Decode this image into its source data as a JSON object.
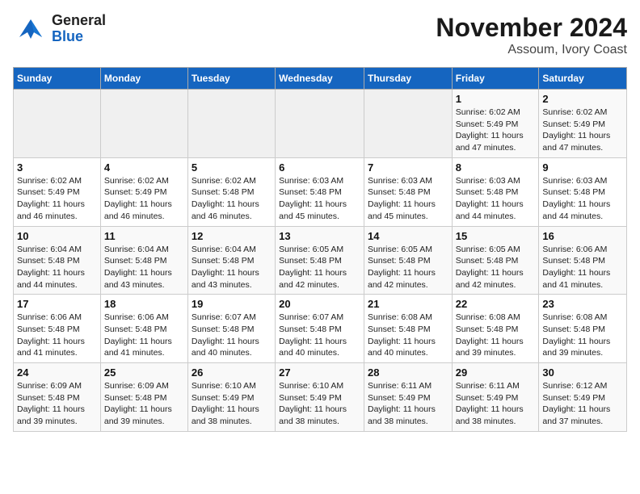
{
  "header": {
    "logo_general": "General",
    "logo_blue": "Blue",
    "main_title": "November 2024",
    "subtitle": "Assoum, Ivory Coast"
  },
  "days_of_week": [
    "Sunday",
    "Monday",
    "Tuesday",
    "Wednesday",
    "Thursday",
    "Friday",
    "Saturday"
  ],
  "weeks": [
    [
      {
        "day": "",
        "info": ""
      },
      {
        "day": "",
        "info": ""
      },
      {
        "day": "",
        "info": ""
      },
      {
        "day": "",
        "info": ""
      },
      {
        "day": "",
        "info": ""
      },
      {
        "day": "1",
        "info": "Sunrise: 6:02 AM\nSunset: 5:49 PM\nDaylight: 11 hours and 47 minutes."
      },
      {
        "day": "2",
        "info": "Sunrise: 6:02 AM\nSunset: 5:49 PM\nDaylight: 11 hours and 47 minutes."
      }
    ],
    [
      {
        "day": "3",
        "info": "Sunrise: 6:02 AM\nSunset: 5:49 PM\nDaylight: 11 hours and 46 minutes."
      },
      {
        "day": "4",
        "info": "Sunrise: 6:02 AM\nSunset: 5:49 PM\nDaylight: 11 hours and 46 minutes."
      },
      {
        "day": "5",
        "info": "Sunrise: 6:02 AM\nSunset: 5:48 PM\nDaylight: 11 hours and 46 minutes."
      },
      {
        "day": "6",
        "info": "Sunrise: 6:03 AM\nSunset: 5:48 PM\nDaylight: 11 hours and 45 minutes."
      },
      {
        "day": "7",
        "info": "Sunrise: 6:03 AM\nSunset: 5:48 PM\nDaylight: 11 hours and 45 minutes."
      },
      {
        "day": "8",
        "info": "Sunrise: 6:03 AM\nSunset: 5:48 PM\nDaylight: 11 hours and 44 minutes."
      },
      {
        "day": "9",
        "info": "Sunrise: 6:03 AM\nSunset: 5:48 PM\nDaylight: 11 hours and 44 minutes."
      }
    ],
    [
      {
        "day": "10",
        "info": "Sunrise: 6:04 AM\nSunset: 5:48 PM\nDaylight: 11 hours and 44 minutes."
      },
      {
        "day": "11",
        "info": "Sunrise: 6:04 AM\nSunset: 5:48 PM\nDaylight: 11 hours and 43 minutes."
      },
      {
        "day": "12",
        "info": "Sunrise: 6:04 AM\nSunset: 5:48 PM\nDaylight: 11 hours and 43 minutes."
      },
      {
        "day": "13",
        "info": "Sunrise: 6:05 AM\nSunset: 5:48 PM\nDaylight: 11 hours and 42 minutes."
      },
      {
        "day": "14",
        "info": "Sunrise: 6:05 AM\nSunset: 5:48 PM\nDaylight: 11 hours and 42 minutes."
      },
      {
        "day": "15",
        "info": "Sunrise: 6:05 AM\nSunset: 5:48 PM\nDaylight: 11 hours and 42 minutes."
      },
      {
        "day": "16",
        "info": "Sunrise: 6:06 AM\nSunset: 5:48 PM\nDaylight: 11 hours and 41 minutes."
      }
    ],
    [
      {
        "day": "17",
        "info": "Sunrise: 6:06 AM\nSunset: 5:48 PM\nDaylight: 11 hours and 41 minutes."
      },
      {
        "day": "18",
        "info": "Sunrise: 6:06 AM\nSunset: 5:48 PM\nDaylight: 11 hours and 41 minutes."
      },
      {
        "day": "19",
        "info": "Sunrise: 6:07 AM\nSunset: 5:48 PM\nDaylight: 11 hours and 40 minutes."
      },
      {
        "day": "20",
        "info": "Sunrise: 6:07 AM\nSunset: 5:48 PM\nDaylight: 11 hours and 40 minutes."
      },
      {
        "day": "21",
        "info": "Sunrise: 6:08 AM\nSunset: 5:48 PM\nDaylight: 11 hours and 40 minutes."
      },
      {
        "day": "22",
        "info": "Sunrise: 6:08 AM\nSunset: 5:48 PM\nDaylight: 11 hours and 39 minutes."
      },
      {
        "day": "23",
        "info": "Sunrise: 6:08 AM\nSunset: 5:48 PM\nDaylight: 11 hours and 39 minutes."
      }
    ],
    [
      {
        "day": "24",
        "info": "Sunrise: 6:09 AM\nSunset: 5:48 PM\nDaylight: 11 hours and 39 minutes."
      },
      {
        "day": "25",
        "info": "Sunrise: 6:09 AM\nSunset: 5:48 PM\nDaylight: 11 hours and 39 minutes."
      },
      {
        "day": "26",
        "info": "Sunrise: 6:10 AM\nSunset: 5:49 PM\nDaylight: 11 hours and 38 minutes."
      },
      {
        "day": "27",
        "info": "Sunrise: 6:10 AM\nSunset: 5:49 PM\nDaylight: 11 hours and 38 minutes."
      },
      {
        "day": "28",
        "info": "Sunrise: 6:11 AM\nSunset: 5:49 PM\nDaylight: 11 hours and 38 minutes."
      },
      {
        "day": "29",
        "info": "Sunrise: 6:11 AM\nSunset: 5:49 PM\nDaylight: 11 hours and 38 minutes."
      },
      {
        "day": "30",
        "info": "Sunrise: 6:12 AM\nSunset: 5:49 PM\nDaylight: 11 hours and 37 minutes."
      }
    ]
  ]
}
